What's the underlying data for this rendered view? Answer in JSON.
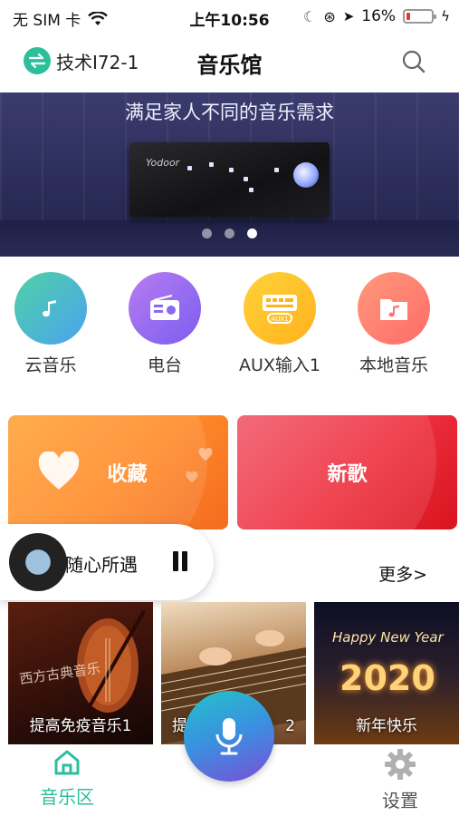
{
  "status_bar": {
    "carrier": "无 SIM 卡",
    "time": "上午10:56",
    "battery_text": "16%",
    "battery_level": 0.16
  },
  "header": {
    "device_name": "技术I72-1",
    "title": "音乐馆"
  },
  "banner": {
    "text": "满足家人不同的音乐需求",
    "device_brand": "Yodoor",
    "slide_count": 3,
    "active_slide": 3
  },
  "categories": [
    {
      "label": "云音乐",
      "icon": "music-note-icon",
      "color_from": "#4fd1a5",
      "color_to": "#4aa3f0"
    },
    {
      "label": "电台",
      "icon": "radio-icon",
      "color_from": "#b77cf0",
      "color_to": "#7b5ef0"
    },
    {
      "label": "AUX输入1",
      "icon": "aux-input-icon",
      "color_from": "#ffd23a",
      "color_to": "#ffb21c"
    },
    {
      "label": "本地音乐",
      "icon": "music-folder-icon",
      "color_from": "#ff9a7a",
      "color_to": "#ff6a6a"
    }
  ],
  "cards": {
    "favorites": "收藏",
    "new_songs": "新歌"
  },
  "now_playing": {
    "title": "随心所遇",
    "state": "playing"
  },
  "section": {
    "more_label": "更多>"
  },
  "albums": [
    {
      "label": "提高免疫音乐1",
      "overlay": "西方古典音乐"
    },
    {
      "label": "提",
      "label_tail": "2"
    },
    {
      "label": "新年快乐",
      "overlay_top": "Happy New Year",
      "overlay_year": "2020"
    }
  ],
  "tabs": {
    "music": "音乐区",
    "settings": "设置",
    "active": "music"
  },
  "colors": {
    "accent": "#2dbf9c",
    "inactive": "#888888"
  }
}
